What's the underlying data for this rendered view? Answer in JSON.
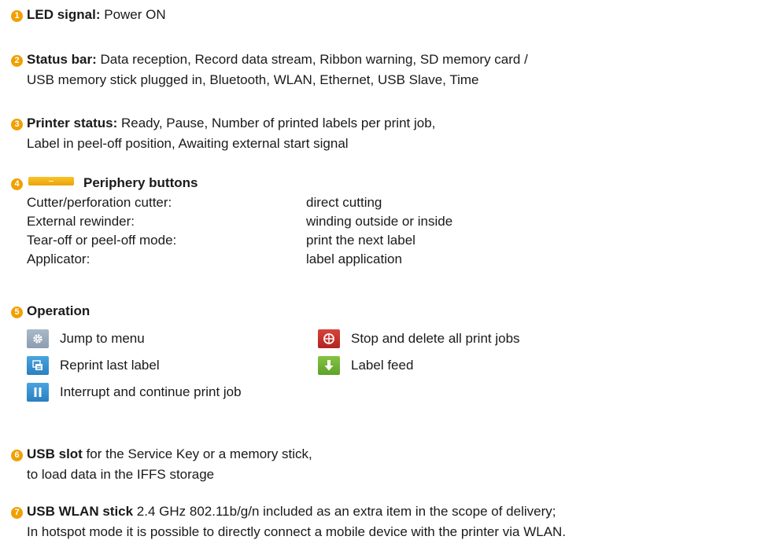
{
  "items": {
    "i1": {
      "num": "1",
      "title": "LED signal:",
      "text": " Power ON"
    },
    "i2": {
      "num": "2",
      "title": "Status bar:",
      "text": " Data reception, Record data stream, Ribbon warning, SD memory card /",
      "text2": "USB memory stick plugged in, Bluetooth, WLAN, Ethernet, USB Slave, Time"
    },
    "i3": {
      "num": "3",
      "title": "Printer status:",
      "text": " Ready, Pause, Number of printed labels per print job,",
      "text2": "Label in peel-off position, Awaiting external start signal"
    },
    "i4": {
      "num": "4",
      "title": "Periphery buttons",
      "rows": [
        {
          "label": "Cutter/perforation cutter:",
          "value": "direct cutting"
        },
        {
          "label": "External rewinder:",
          "value": "winding outside or inside"
        },
        {
          "label": "Tear-off or peel-off mode:",
          "value": "print the next label"
        },
        {
          "label": "Applicator:",
          "value": "label application"
        }
      ]
    },
    "i5": {
      "num": "5",
      "title": "Operation",
      "ops": {
        "menu": {
          "icon": "gear-icon",
          "label": "Jump to menu"
        },
        "stop": {
          "icon": "stop-icon",
          "label": "Stop and delete all print jobs"
        },
        "reprint": {
          "icon": "reprint-icon",
          "label": "Reprint last label"
        },
        "feed": {
          "icon": "arrow-down-icon",
          "label": "Label feed"
        },
        "pause": {
          "icon": "pause-icon",
          "label": "Interrupt and continue print job"
        }
      }
    },
    "i6": {
      "num": "6",
      "title": "USB slot",
      "text": " for the Service Key or a memory stick,",
      "text2": "to load data in the IFFS storage"
    },
    "i7": {
      "num": "7",
      "title": "USB WLAN stick",
      "text": " 2.4 GHz 802.11b/g/n included as an extra item in the scope of delivery;",
      "text2": "In hotspot mode it is possible to directly connect a mobile device with the printer via WLAN."
    }
  },
  "colors": {
    "badge": "#f0a000",
    "periphery_button": "#f2b21a",
    "menu_icon": "#9aacbe",
    "stop_icon": "#c8312c",
    "reprint_icon": "#3a92d0",
    "feed_icon": "#72b337",
    "pause_icon": "#3a92d0"
  }
}
